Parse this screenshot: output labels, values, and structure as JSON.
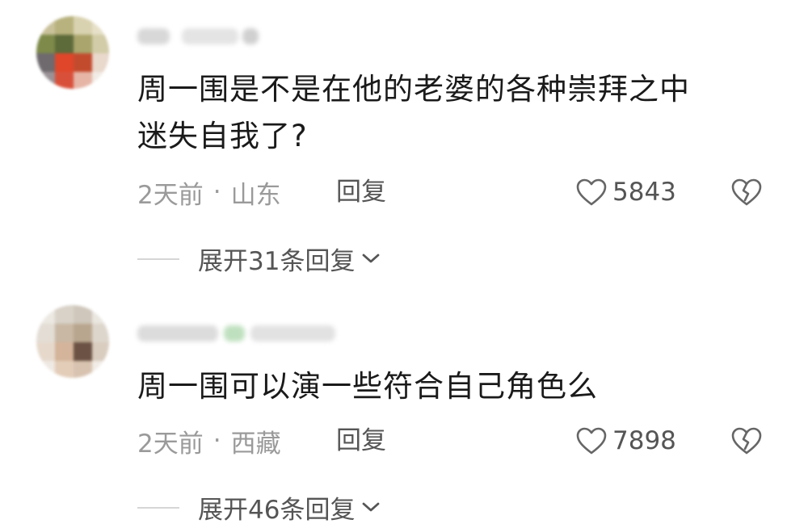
{
  "comments": [
    {
      "text": "周一围是不是在他的老婆的各种崇拜之中\n迷失自我了?",
      "time": "2天前",
      "separator": "·",
      "location": "山东",
      "reply_label": "回复",
      "likes": "5843",
      "expand_label": "展开31条回复"
    },
    {
      "text": "周一围可以演一些符合自己角色么",
      "time": "2天前",
      "separator": "·",
      "location": "西藏",
      "reply_label": "回复",
      "likes": "7898",
      "expand_label": "展开46条回复"
    }
  ],
  "icons": {
    "like": "heart-outline-icon",
    "dislike": "broken-heart-icon",
    "expand": "chevron-down-icon"
  },
  "colors": {
    "text_primary": "#1a1a1a",
    "text_secondary": "#9a9a9a",
    "text_action": "#555555",
    "background": "#ffffff"
  }
}
